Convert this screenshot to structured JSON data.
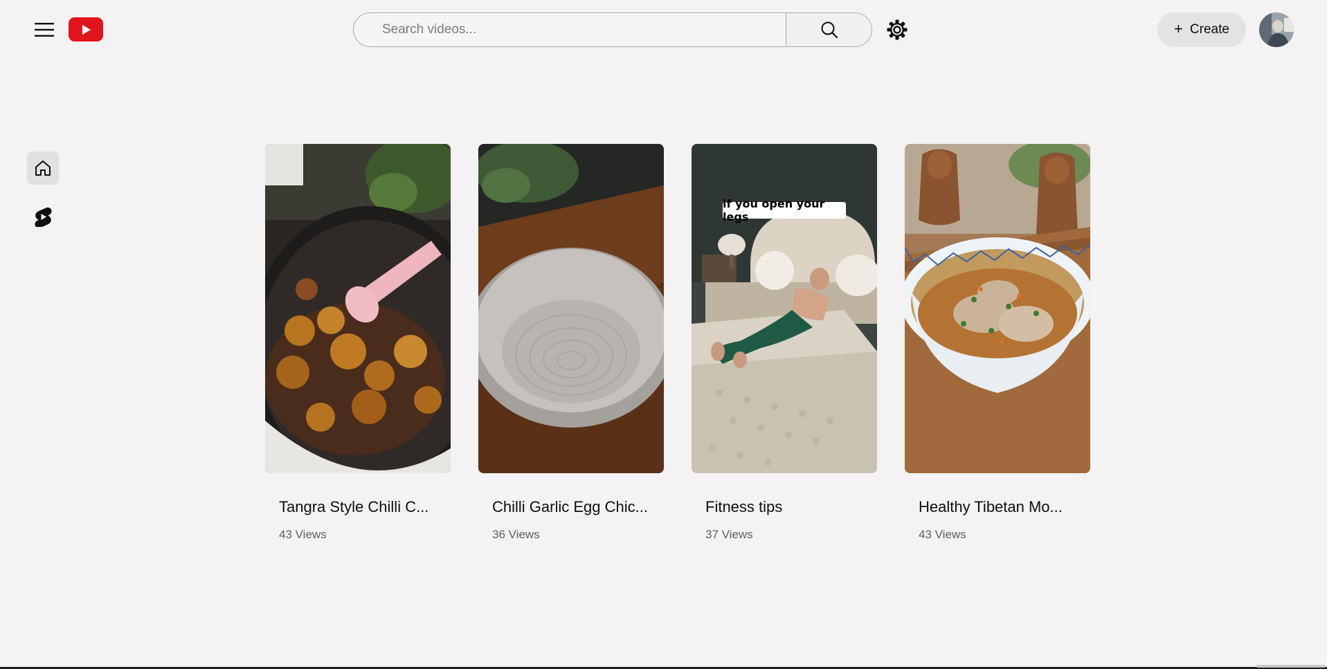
{
  "header": {
    "menu_icon": "hamburger-menu-icon",
    "logo_icon": "youtube-play-logo-icon",
    "search": {
      "placeholder": "Search videos...",
      "value": "",
      "icon": "search-icon"
    },
    "settings_icon": "gear-icon",
    "create": {
      "label": "Create",
      "icon": "plus-icon"
    },
    "avatar_icon": "user-avatar"
  },
  "sidebar": {
    "items": [
      {
        "name": "home",
        "icon": "home-icon",
        "active": true
      },
      {
        "name": "shorts",
        "icon": "shorts-icon",
        "active": false
      }
    ]
  },
  "videos": [
    {
      "title": "Tangra Style Chilli C...",
      "views": "43 Views",
      "thumbnail": "chilli-chicken-wok"
    },
    {
      "title": "Chilli Garlic Egg Chic...",
      "views": "36 Views",
      "thumbnail": "empty-ceramic-plate"
    },
    {
      "title": "Fitness tips",
      "views": "37 Views",
      "thumbnail": "man-on-bed",
      "overlay_text": "if you open your legs"
    },
    {
      "title": "Healthy Tibetan Mo...",
      "views": "43 Views",
      "thumbnail": "momo-soup-bowl"
    }
  ],
  "colors": {
    "background": "#f4f2f3",
    "brand_red": "#e0141c",
    "active_item": "#e2e0e1"
  }
}
